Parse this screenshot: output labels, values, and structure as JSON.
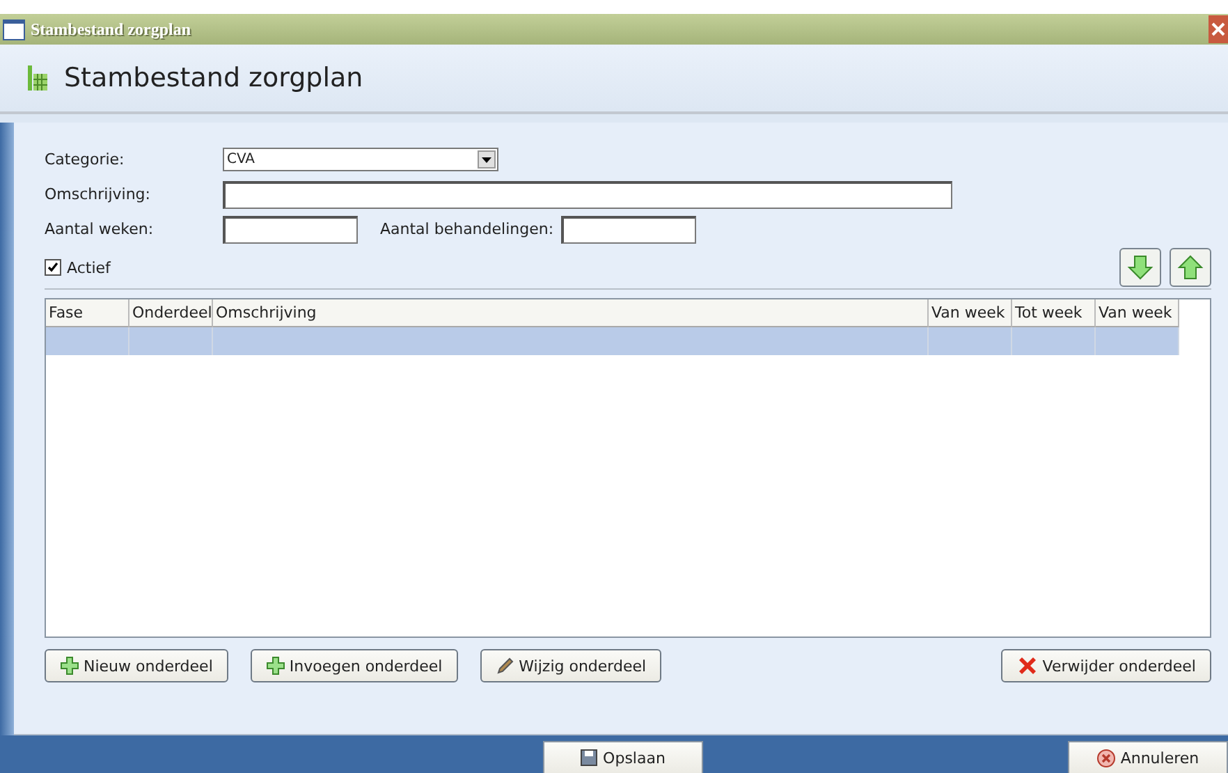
{
  "window": {
    "title": "Stambestand zorgplan"
  },
  "header": {
    "title": "Stambestand zorgplan"
  },
  "form": {
    "category_label": "Categorie:",
    "category_value": "CVA",
    "description_label": "Omschrijving:",
    "weeks_label": "Aantal weken:",
    "treatments_label": "Aantal behandelingen:",
    "active": {
      "label": "Actief",
      "checked": true
    }
  },
  "table": {
    "columns": [
      "Fase",
      "Onderdeel",
      "Omschrijving",
      "Van week",
      "Tot week",
      "Van week"
    ],
    "rows": [
      {
        "selected": true
      }
    ]
  },
  "row_buttons": [
    {
      "label": "Nieuw onderdeel",
      "kind": "add"
    },
    {
      "label": "Invoegen onderdeel",
      "kind": "add"
    },
    {
      "label": "Wijzig onderdeel",
      "kind": "edit"
    },
    {
      "label": "Verwijder onderdeel",
      "kind": "delete"
    }
  ],
  "footer_buttons": [
    {
      "label": "Opslaan",
      "kind": "save"
    },
    {
      "label": "Annuleren",
      "kind": "cancel"
    }
  ]
}
